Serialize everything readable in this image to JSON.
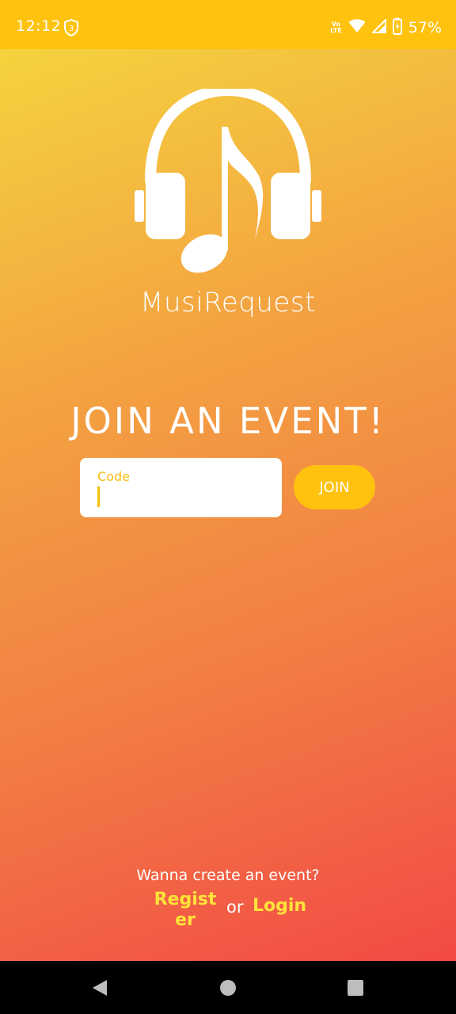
{
  "status_bar": {
    "time": "12:12",
    "shield_badge": "3",
    "network_label_top": "Vo",
    "network_label_bottom": "LTE",
    "battery_percent": "57%",
    "icons": [
      "shield-icon",
      "wifi-icon",
      "signal-icon",
      "battery-icon"
    ]
  },
  "colors": {
    "accent_yellow": "#FFC20E",
    "link_yellow": "#FFE33A",
    "gradient_top": "#F5D33E",
    "gradient_bottom": "#F24A45"
  },
  "brand": {
    "logo_icon": "headphones-music-note-icon",
    "app_name": "MusiRequest"
  },
  "join": {
    "title": "JOIN AN EVENT!",
    "code_label": "Code",
    "code_value": "",
    "button_label": "JOIN"
  },
  "footer": {
    "prompt": "Wanna create an event?",
    "register_label": "Register",
    "or_label": "or",
    "login_label": "Login"
  },
  "nav_bar": {
    "icons": [
      "back-icon",
      "home-icon",
      "recents-icon"
    ]
  }
}
